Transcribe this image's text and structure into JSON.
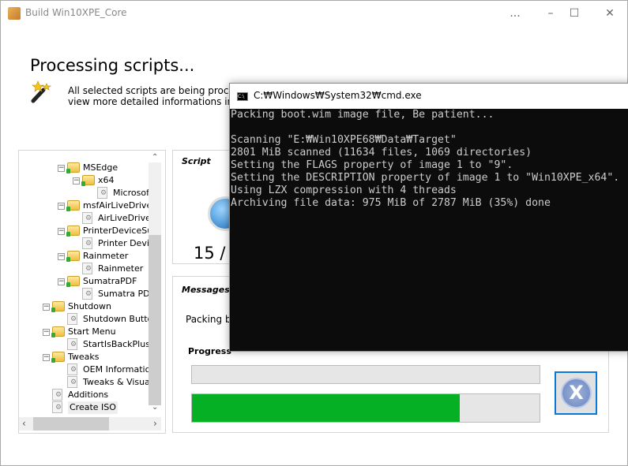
{
  "window": {
    "title": "Build Win10XPE_Core",
    "more": "...",
    "minimize": "–",
    "maximize": "☐",
    "close": "✕"
  },
  "header": {
    "title": "Processing scripts...",
    "description_line1": "All selected scripts are being processe",
    "description_line2": "view more detailed informations inside"
  },
  "tree": {
    "items": [
      {
        "label": "MSEdge",
        "level": 2,
        "type": "folder"
      },
      {
        "label": "x64",
        "level": 3,
        "type": "folder"
      },
      {
        "label": "Microsoft",
        "level": 4,
        "type": "file"
      },
      {
        "label": "msfAirLiveDrive",
        "level": 2,
        "type": "folder"
      },
      {
        "label": "AirLiveDrive",
        "level": 3,
        "type": "file"
      },
      {
        "label": "PrinterDeviceSup",
        "level": 2,
        "type": "folder"
      },
      {
        "label": "Printer Devic",
        "level": 3,
        "type": "file"
      },
      {
        "label": "Rainmeter",
        "level": 2,
        "type": "folder"
      },
      {
        "label": "Rainmeter",
        "level": 3,
        "type": "file"
      },
      {
        "label": "SumatraPDF",
        "level": 2,
        "type": "folder"
      },
      {
        "label": "Sumatra PDF",
        "level": 3,
        "type": "file"
      },
      {
        "label": "Shutdown",
        "level": 1,
        "type": "folder"
      },
      {
        "label": "Shutdown Button",
        "level": 2,
        "type": "file"
      },
      {
        "label": "Start Menu",
        "level": 1,
        "type": "folder"
      },
      {
        "label": "StartIsBackPlus",
        "level": 2,
        "type": "file"
      },
      {
        "label": "Tweaks",
        "level": 1,
        "type": "folder"
      },
      {
        "label": "OEM Information",
        "level": 2,
        "type": "file"
      },
      {
        "label": "Tweaks & Visual E",
        "level": 2,
        "type": "file"
      },
      {
        "label": "Additions",
        "level": 1,
        "type": "file"
      },
      {
        "label": "Create ISO",
        "level": 1,
        "type": "file",
        "selected": true
      }
    ]
  },
  "script_group": {
    "title": "Script",
    "counter": "15 /"
  },
  "messages_group": {
    "title": "Messages",
    "message": "Packing bo",
    "progress_label": "Progress",
    "progress_bar_1_percent": 0,
    "progress_bar_2_percent": 77,
    "progress_color": "#06b025"
  },
  "cmd": {
    "title": "C:₩Windows₩System32₩cmd.exe",
    "lines": [
      "Packing boot.wim image file, Be patient...",
      "",
      "Scanning \"E:₩Win10XPE68₩Data₩Target\"",
      "2801 MiB scanned (11634 files, 1069 directories)",
      "Setting the FLAGS property of image 1 to \"9\".",
      "Setting the DESCRIPTION property of image 1 to \"Win10XPE_x64\".",
      "Using LZX compression with 4 threads",
      "Archiving file data: 975 MiB of 2787 MiB (35%) done"
    ]
  }
}
